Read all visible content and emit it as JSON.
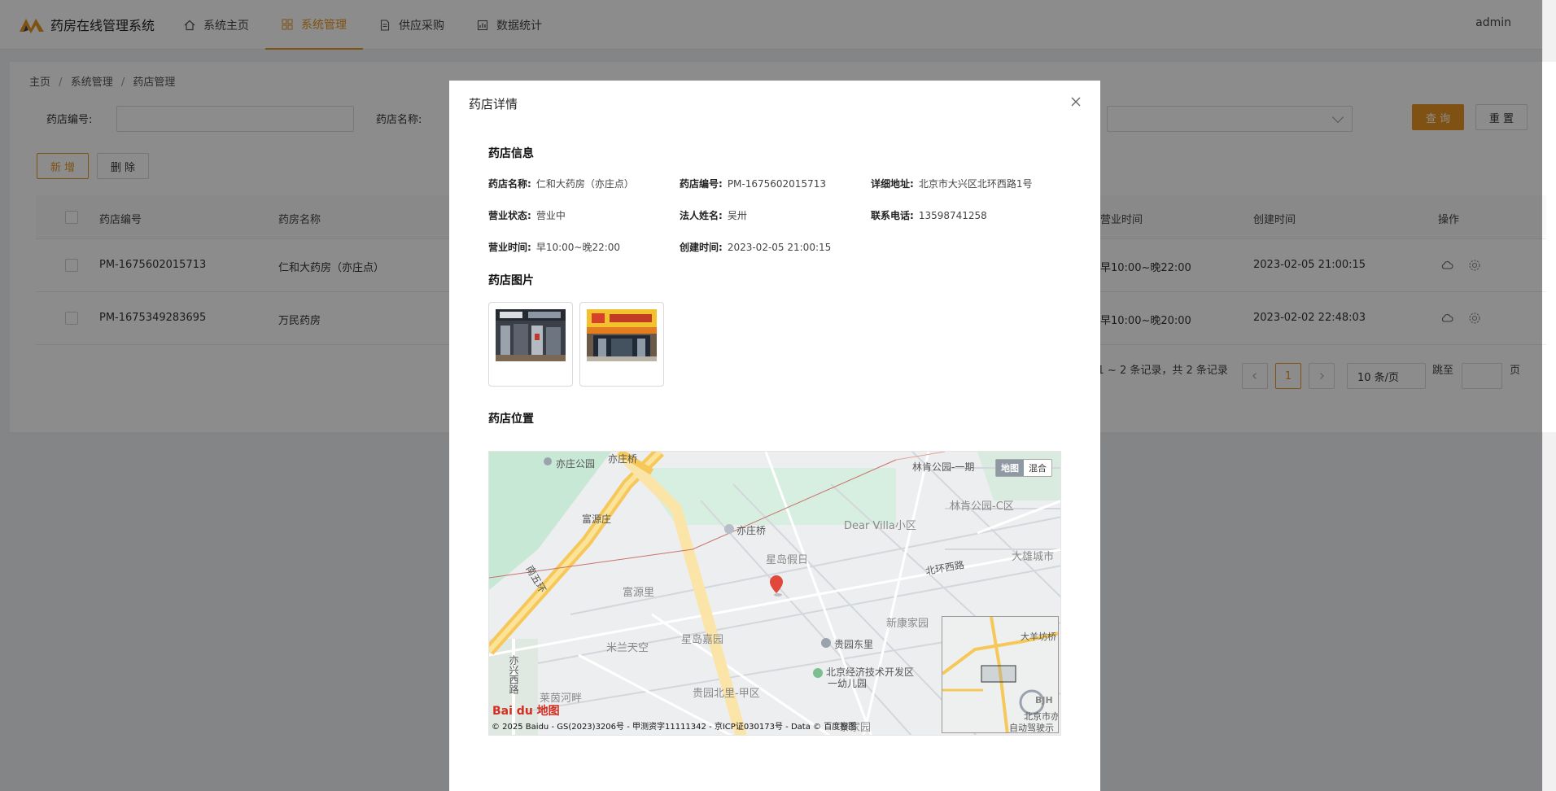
{
  "app": {
    "title": "药房在线管理系统",
    "user": "admin"
  },
  "nav": [
    {
      "label": "系统主页",
      "icon": "home-icon"
    },
    {
      "label": "系统管理",
      "icon": "grid-icon",
      "active": true
    },
    {
      "label": "供应采购",
      "icon": "document-icon"
    },
    {
      "label": "数据统计",
      "icon": "chart-icon"
    }
  ],
  "breadcrumb": [
    "主页",
    "系统管理",
    "药店管理"
  ],
  "filters": {
    "code_label": "药店编号:",
    "name_label": "药店名称:",
    "search_button": "查 询",
    "reset_button": "重 置"
  },
  "actions": {
    "add": "新 增",
    "delete": "删 除"
  },
  "table": {
    "headers": [
      "药店编号",
      "药房名称",
      "营业时间",
      "创建时间",
      "操作"
    ],
    "rows": [
      {
        "code": "PM-1675602015713",
        "name": "仁和大药房（亦庄点）",
        "hours": "早10:00~晚22:00",
        "created": "2023-02-05 21:00:15"
      },
      {
        "code": "PM-1675349283695",
        "name": "万民药房",
        "hours": "早10:00~晚20:00",
        "created": "2023-02-02 22:48:03"
      }
    ]
  },
  "pagination": {
    "summary": ": 1 ~ 2 条记录，共 2 条记录",
    "current": "1",
    "page_size": "10 条/页",
    "jump_label": "跳至",
    "page_suffix": "页"
  },
  "modal": {
    "title": "药店详情",
    "info_title": "药店信息",
    "fields": {
      "name_k": "药店名称:",
      "name_v": "仁和大药房（亦庄点）",
      "code_k": "药店编号:",
      "code_v": "PM-1675602015713",
      "addr_k": "详细地址:",
      "addr_v": "北京市大兴区北环西路1号",
      "status_k": "营业状态:",
      "status_v": "营业中",
      "owner_k": "法人姓名:",
      "owner_v": "吴卅",
      "phone_k": "联系电话:",
      "phone_v": "13598741258",
      "hours_k": "营业时间:",
      "hours_v": "早10:00~晚22:00",
      "created_k": "创建时间:",
      "created_v": "2023-02-05 21:00:15"
    },
    "images_title": "药店图片",
    "location_title": "药店位置"
  },
  "map": {
    "type_map": "地图",
    "type_hybrid": "混合",
    "labels": {
      "l1": "亦庄公园",
      "l2": "亦庄桥",
      "l3": "林肯公园-一期",
      "l4": "林肯公园-C区",
      "l5": "富源庄",
      "l6": "亦庄桥",
      "l7": "Dear Villa小区",
      "l8": "大雄城市",
      "l9": "星岛假日",
      "l10": "北环西路",
      "l11": "富源里",
      "l12": "南五环",
      "l13": "新康家园",
      "l14": "米兰天空",
      "l15": "星岛嘉园",
      "l16": "贵园东里",
      "l17": "北京经济技术开发区",
      "l18": "一幼儿园",
      "l19": "亦兴西路",
      "l20": "莱茵河畔",
      "l21": "贵园北里-甲区",
      "l22": "泰家园",
      "o1": "大羊坊桥",
      "o2": "北京市亦",
      "o3": "自动驾驶示",
      "o4": "BJH"
    },
    "logo": "Bai du 地图",
    "copyright": "© 2025 Baidu - GS(2023)3206号 - 甲测资字11111342 - 京ICP证030173号 - Data © 百度智图"
  },
  "colors": {
    "accent": "#e89623",
    "mask": "rgba(0,0,0,0.45)"
  }
}
